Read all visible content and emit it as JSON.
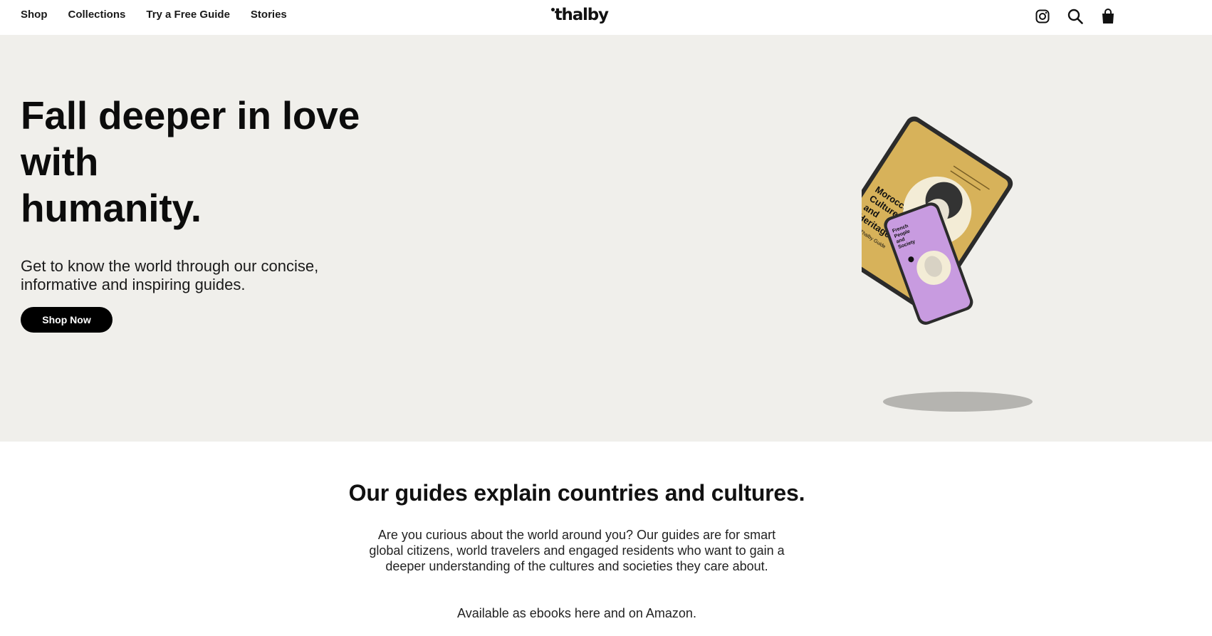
{
  "header": {
    "nav": [
      "Shop",
      "Collections",
      "Try a Free Guide",
      "Stories"
    ],
    "logo": "thalby",
    "icons": [
      "instagram-icon",
      "search-icon",
      "bag-icon"
    ]
  },
  "hero": {
    "title_line1": "Fall deeper in love",
    "title_line2": "with",
    "title_line3": "humanity.",
    "subtitle": "Get to know the world through our concise, informative and inspiring guides.",
    "cta": "Shop Now",
    "tablet_book_title": "Moroccan Culture and Heritage",
    "tablet_book_subtitle": "The Thalby Guide",
    "phone_book_title": "French People and Society",
    "colors": {
      "background": "#f0efeb",
      "tablet_cover": "#d7b25a",
      "phone_cover": "#c89be0"
    }
  },
  "guides": {
    "title": "Our guides explain countries and cultures.",
    "body": "Are you curious about the world around you? Our guides are for smart global citizens, world travelers and engaged residents who want to gain a deeper understanding of the cultures and societies they care about.",
    "note": "Available as ebooks here and on Amazon."
  }
}
